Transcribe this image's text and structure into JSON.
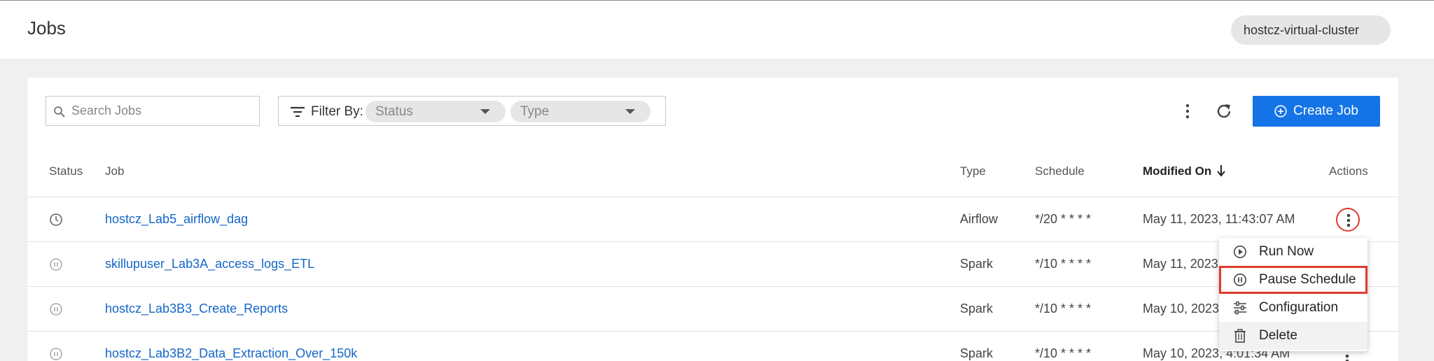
{
  "header": {
    "title": "Jobs",
    "cluster": "hostcz-virtual-cluster"
  },
  "toolbar": {
    "search_placeholder": "Search Jobs",
    "filter_label": "Filter By:",
    "status_select": "Status",
    "type_select": "Type",
    "create_label": "Create Job"
  },
  "table": {
    "columns": {
      "status": "Status",
      "job": "Job",
      "type": "Type",
      "schedule": "Schedule",
      "modified": "Modified On",
      "actions": "Actions"
    },
    "rows": [
      {
        "status_icon": "clock-icon",
        "name": "hostcz_Lab5_airflow_dag",
        "type": "Airflow",
        "schedule": "*/20 * * * *",
        "modified": "May 11, 2023, 11:43:07 AM"
      },
      {
        "status_icon": "pause-circle-icon",
        "name": "skillupuser_Lab3A_access_logs_ETL",
        "type": "Spark",
        "schedule": "*/10 * * * *",
        "modified": "May 11, 2023"
      },
      {
        "status_icon": "pause-circle-icon",
        "name": "hostcz_Lab3B3_Create_Reports",
        "type": "Spark",
        "schedule": "*/10 * * * *",
        "modified": "May 10, 2023"
      },
      {
        "status_icon": "pause-circle-icon",
        "name": "hostcz_Lab3B2_Data_Extraction_Over_150k",
        "type": "Spark",
        "schedule": "*/10 * * * *",
        "modified": "May 10, 2023, 4:01:34 AM"
      }
    ]
  },
  "action_menu": {
    "items": [
      {
        "label": "Run Now",
        "icon": "play-circle-icon"
      },
      {
        "label": "Pause Schedule",
        "icon": "pause-circle-icon"
      },
      {
        "label": "Configuration",
        "icon": "sliders-icon"
      },
      {
        "label": "Delete",
        "icon": "trash-icon"
      }
    ]
  },
  "colors": {
    "accent": "#1473e6",
    "link": "#1466c8",
    "highlight": "#e03a2e"
  }
}
